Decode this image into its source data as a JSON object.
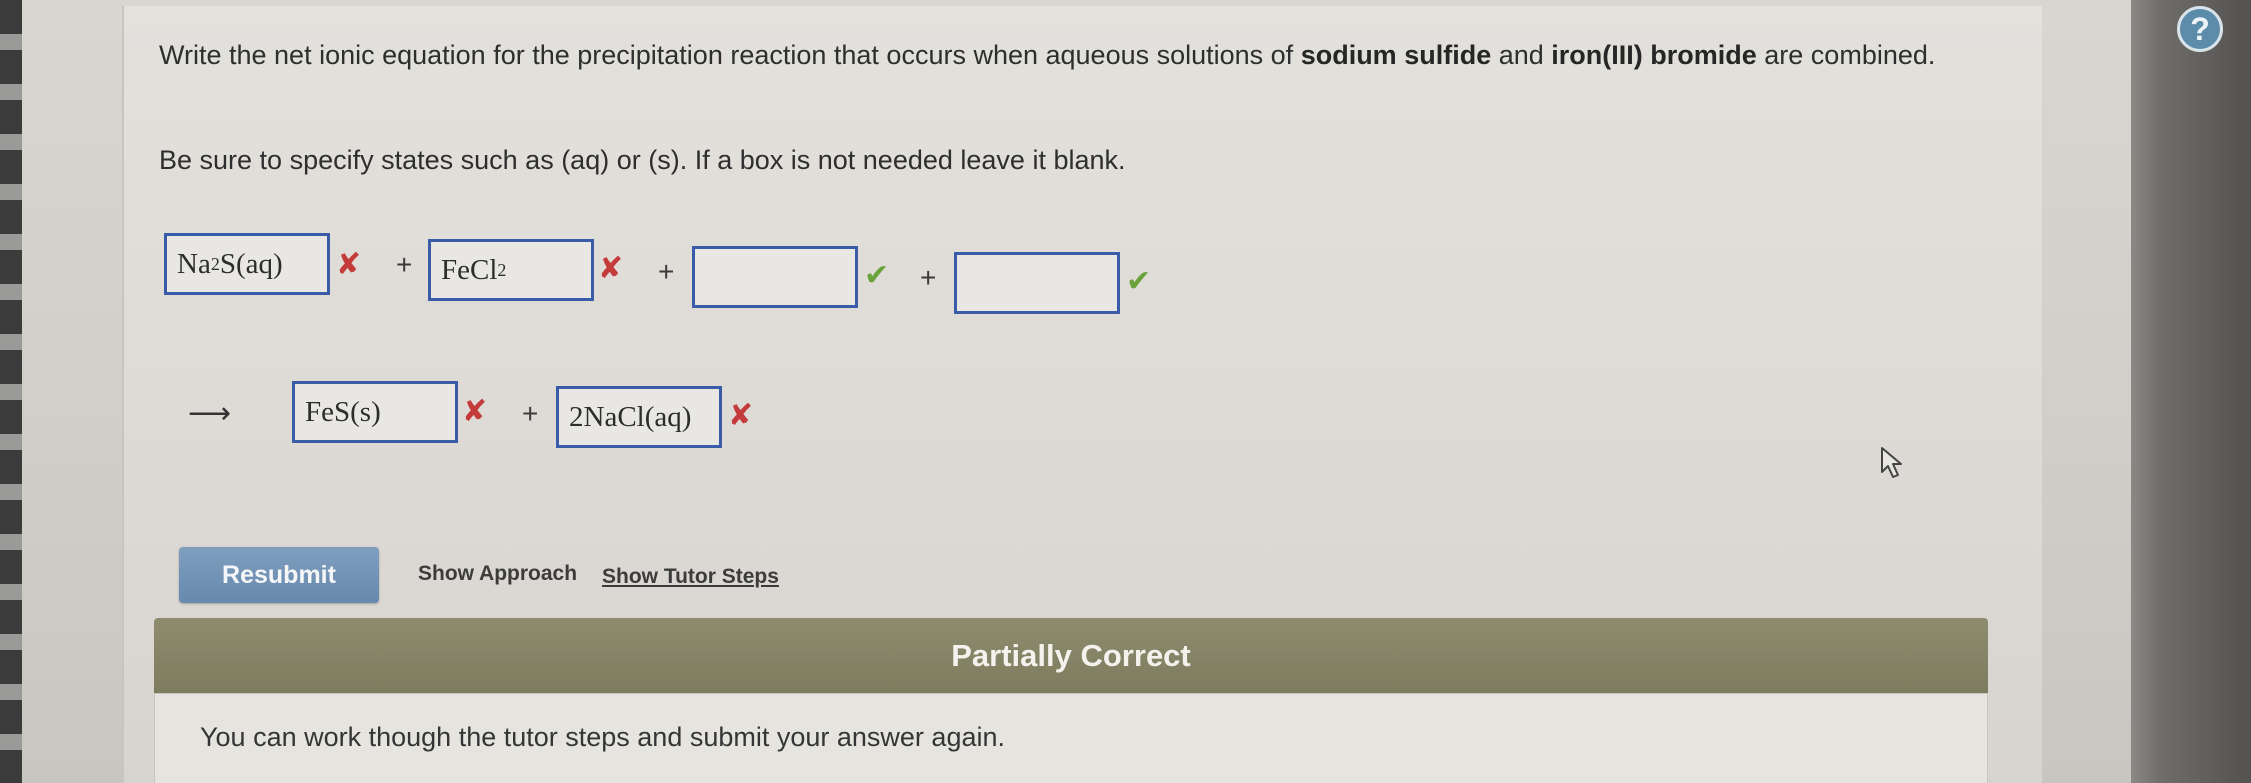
{
  "question": {
    "line1_pre": "Write the net ionic equation for the precipitation reaction that occurs when aqueous solutions of ",
    "reactant1": "sodium sulfide",
    "line1_mid": " and ",
    "reactant2": "iron(III) bromide",
    "line1_post": " are combined.",
    "instruction": "Be sure to specify states such as (aq) or (s). If a box is not needed leave it blank."
  },
  "equation": {
    "box1": {
      "main": "Na",
      "sub": "2",
      "rest": "S(aq)",
      "status": "incorrect"
    },
    "box2": {
      "main": "FeCl",
      "sub": "2",
      "rest": "",
      "status": "incorrect"
    },
    "box3": {
      "value": "",
      "status": "correct"
    },
    "box4": {
      "value": "",
      "status": "correct"
    },
    "box5": {
      "value": "FeS(s)",
      "status": "incorrect"
    },
    "box6": {
      "value": "2NaCl(aq)",
      "status": "incorrect"
    },
    "plus": "+",
    "arrow": "⟶",
    "x_symbol": "✘",
    "check_symbol": "✔"
  },
  "actions": {
    "resubmit": "Resubmit",
    "show_approach": "Show Approach",
    "show_tutor_steps": "Show Tutor Steps"
  },
  "feedback": {
    "title": "Partially Correct",
    "message": "You can work though the tutor steps and submit your answer again."
  },
  "help": {
    "symbol": "?"
  },
  "colors": {
    "box_border": "#3a5ca8",
    "incorrect": "#c43b3b",
    "correct": "#6aa33c",
    "feedback_header": "#8e8c6f",
    "button": "#6789ad"
  }
}
